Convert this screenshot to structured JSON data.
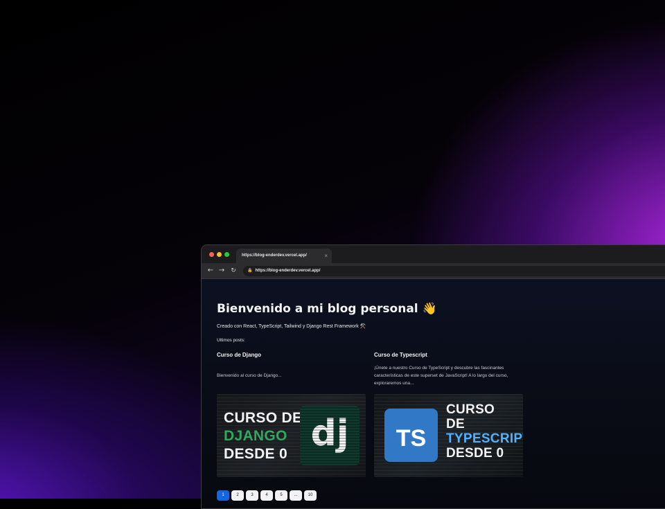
{
  "browser": {
    "tab_title": "https://blog-enderdev.vercel.app/",
    "tab_close": "×",
    "url": "https://blog-enderdev.vercel.app/"
  },
  "page": {
    "title": "Bienvenido a mi blog personal 👋",
    "subtitle": "Creado con React, TypeScript, Tailwind y Django Rest Framework ⚒️",
    "latest_label": "Ultimos posts:"
  },
  "posts": [
    {
      "title": "Curso de Django",
      "description": "Bienvenido al curso de Django...",
      "thumb_line1": "CURSO DE",
      "thumb_line2": "DJANGO",
      "thumb_line3": "DESDE 0",
      "logo_text": "dj"
    },
    {
      "title": "Curso de Typescript",
      "description": "¡Únete a nuestro Curso de TypeScript y descubre las fascinantes características de este superset de JavaScript! A lo largo del curso, exploraremos una...",
      "thumb_line1": "CURSO",
      "thumb_line2": "DE",
      "thumb_line3": "TYPESCRIPT",
      "thumb_line4": "DESDE 0",
      "logo_text": "TS"
    }
  ],
  "pagination": {
    "pages": [
      "1",
      "2",
      "3",
      "4",
      "5",
      "...",
      "10"
    ],
    "current": "1"
  },
  "colors": {
    "accent_blue": "#1565e0",
    "django_green": "#2fa860",
    "typescript_blue": "#3178c6"
  }
}
